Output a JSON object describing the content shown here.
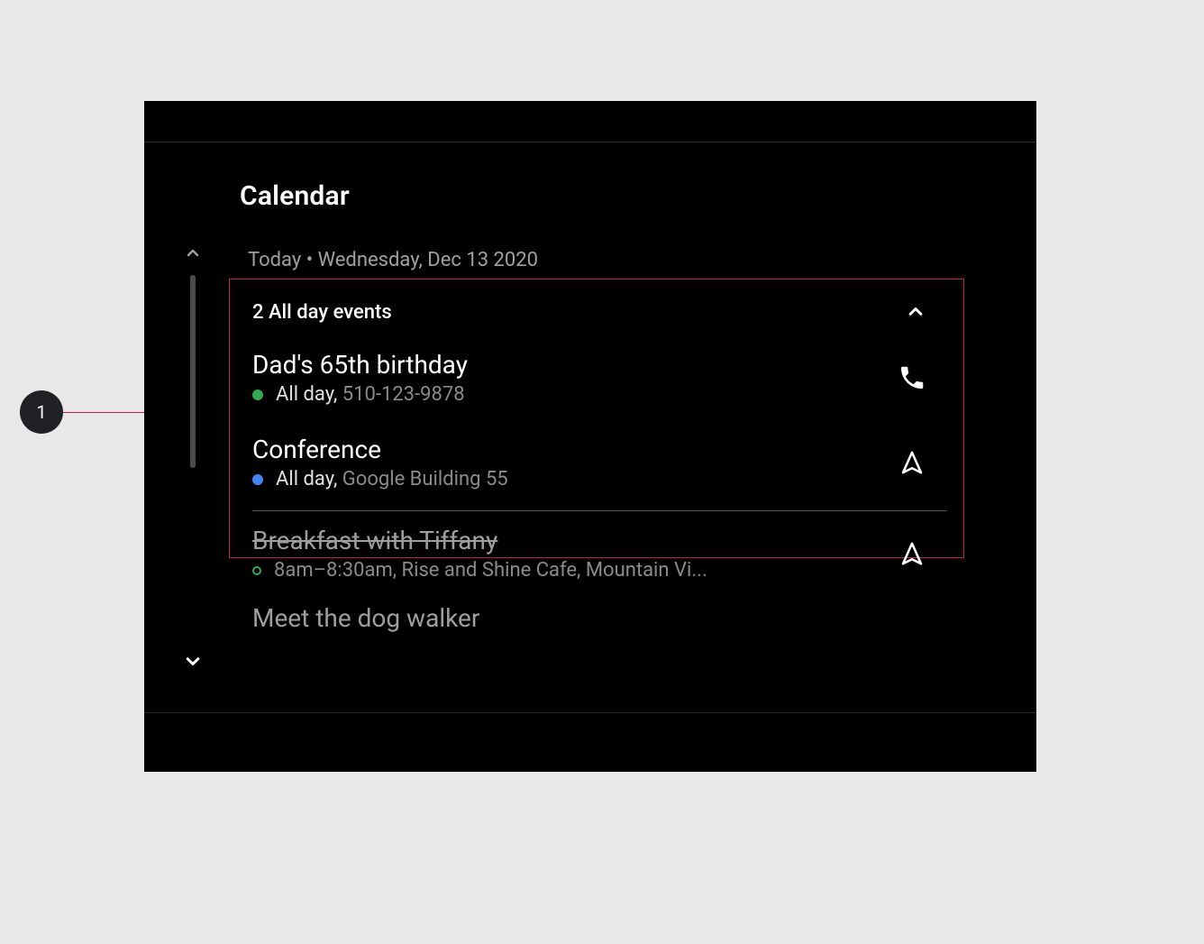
{
  "app": {
    "title": "Calendar"
  },
  "date": {
    "line": "Today • Wednesday, Dec 13 2020"
  },
  "allDay": {
    "header": "2 All day events",
    "events": [
      {
        "title": "Dad's 65th birthday",
        "time": "All day,",
        "detail": "510-123-9878",
        "dotColor": "green",
        "action": "phone"
      },
      {
        "title": "Conference",
        "time": "All day,",
        "detail": "Google Building 55",
        "dotColor": "blue",
        "action": "navigate"
      }
    ]
  },
  "otherEvents": [
    {
      "title": "Breakfast with Tiffany",
      "time": "8am–8:30am,",
      "detail": "Rise and Shine Cafe, Mountain Vi...",
      "dotColor": "ring-green",
      "action": "navigate",
      "past": true
    },
    {
      "title": "Meet the dog walker"
    }
  ],
  "annotation": {
    "label": "1"
  }
}
